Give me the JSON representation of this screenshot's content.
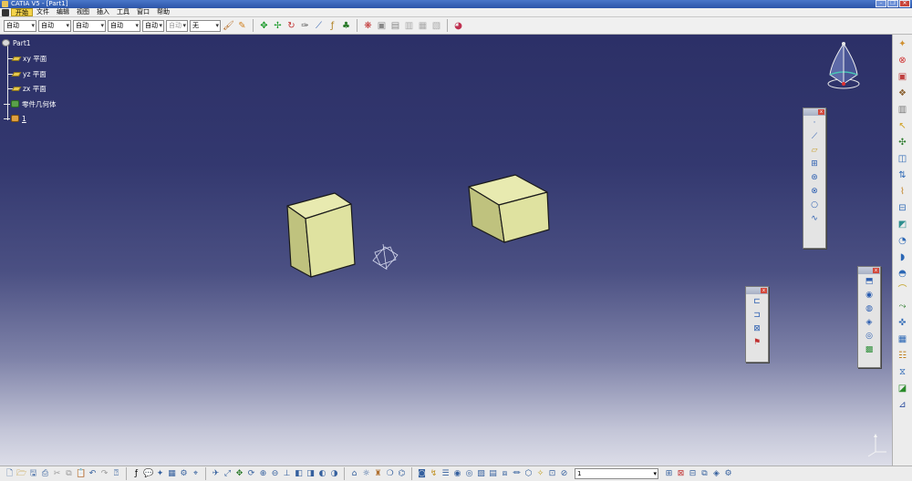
{
  "window": {
    "title": "CATIA V5 - [Part1]",
    "minimize": "–",
    "restore": "❐",
    "close": "✕"
  },
  "menu": {
    "items": [
      "开始",
      "文件",
      "编辑",
      "视图",
      "插入",
      "工具",
      "窗口",
      "帮助"
    ]
  },
  "toolbar": {
    "combos": [
      {
        "value": "自动"
      },
      {
        "value": "自动"
      },
      {
        "value": "自动"
      },
      {
        "value": "自动"
      },
      {
        "value": "自动"
      },
      {
        "value": "自动"
      },
      {
        "value": "无"
      }
    ]
  },
  "tree": {
    "root": "Part1",
    "items": [
      {
        "label": "xy 平面",
        "icon": "plane-icon"
      },
      {
        "label": "yz 平面",
        "icon": "plane-icon"
      },
      {
        "label": "zx 平面",
        "icon": "plane-icon"
      },
      {
        "label": "零件几何体",
        "icon": "part-body-icon"
      },
      {
        "label": "1",
        "icon": "geometrical-set-icon"
      }
    ]
  },
  "status": {
    "layer_value": "1"
  },
  "colors": {
    "viewport_top": "#2c3067",
    "viewport_bottom": "#dcdde8",
    "solid_face": "#dfe2a0",
    "solid_side": "#bfc27e",
    "solid_top": "#e8eab0",
    "menu_active": "#f4d34c"
  }
}
